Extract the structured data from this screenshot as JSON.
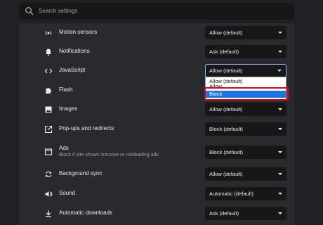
{
  "search": {
    "placeholder": "Search settings"
  },
  "rows": [
    {
      "label": "Motion sensors",
      "value": "Allow (default)",
      "icon": "motion-sensor-icon"
    },
    {
      "label": "Notifications",
      "value": "Ask (default)",
      "icon": "bell-icon"
    },
    {
      "label": "JavaScript",
      "value": "Allow (default)",
      "icon": "code-icon"
    },
    {
      "label": "Flash",
      "value": "",
      "icon": "puzzle-icon"
    },
    {
      "label": "Images",
      "value": "Allow (default)",
      "icon": "image-icon"
    },
    {
      "label": "Pop-ups and redirects",
      "value": "Block (default)",
      "icon": "external-link-icon"
    },
    {
      "label": "Ads",
      "sublabel": "Block if site shows intrusive or misleading ads",
      "value": "Block (default)",
      "icon": "window-icon"
    },
    {
      "label": "Background sync",
      "value": "Allow (default)",
      "icon": "sync-icon"
    },
    {
      "label": "Sound",
      "value": "Automatic (default)",
      "icon": "speaker-icon"
    },
    {
      "label": "Automatic downloads",
      "value": "Ask (default)",
      "icon": "download-icon"
    }
  ],
  "javascript_dropdown": {
    "options": [
      "Allow (default)",
      "Allow",
      "Block"
    ],
    "selected": "Block"
  },
  "colors": {
    "background": "#202124",
    "panel": "#292a2d",
    "accent": "#1a73e8",
    "highlight": "#e3001b"
  }
}
